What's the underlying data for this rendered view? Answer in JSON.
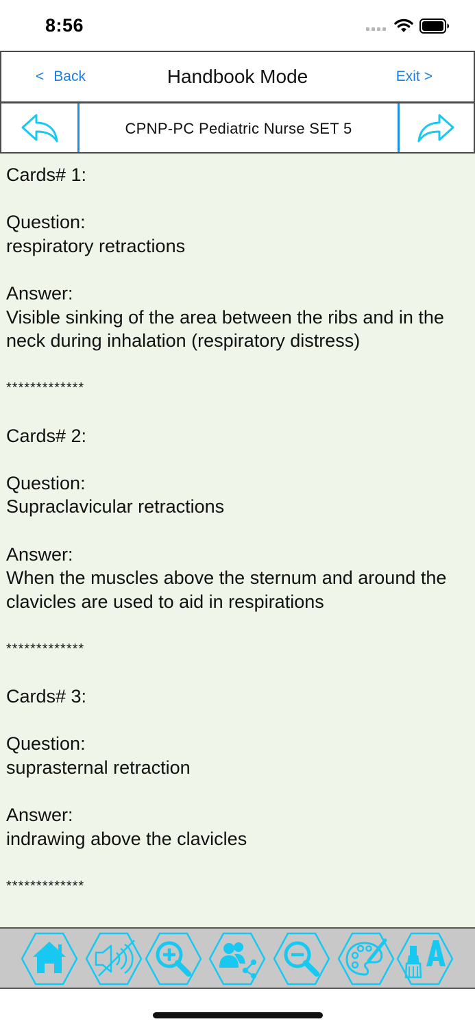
{
  "status_bar": {
    "time": "8:56"
  },
  "header": {
    "back_label": "Back",
    "title": "Handbook Mode",
    "exit_label": "Exit"
  },
  "nav": {
    "set_title": "CPNP-PC Pediatric Nurse SET 5"
  },
  "cards": [
    {
      "heading": "Cards# 1:",
      "question_label": "Question:",
      "question": "respiratory retractions",
      "answer_label": "Answer:",
      "answer": "Visible sinking of the area between the ribs and in the neck during inhalation (respiratory distress)",
      "separator": "*************"
    },
    {
      "heading": "Cards# 2:",
      "question_label": "Question:",
      "question": "Supraclavicular retractions",
      "answer_label": "Answer:",
      "answer": "When the muscles above the sternum and around the clavicles are used to aid in respirations",
      "separator": "*************"
    },
    {
      "heading": "Cards# 3:",
      "question_label": "Question:",
      "question": "suprasternal retraction",
      "answer_label": "Answer:",
      "answer": "indrawing above the clavicles",
      "separator": "*************"
    }
  ],
  "toolbar": {
    "buttons": [
      "home-icon",
      "sound-off-icon",
      "zoom-in-icon",
      "share-icon",
      "zoom-out-icon",
      "palette-icon",
      "font-style-icon"
    ]
  },
  "colors": {
    "accent": "#1a7fe0",
    "icon_cyan": "#19c8f0",
    "content_bg": "#eff5e8",
    "toolbar_bg": "#c8c8c8"
  }
}
